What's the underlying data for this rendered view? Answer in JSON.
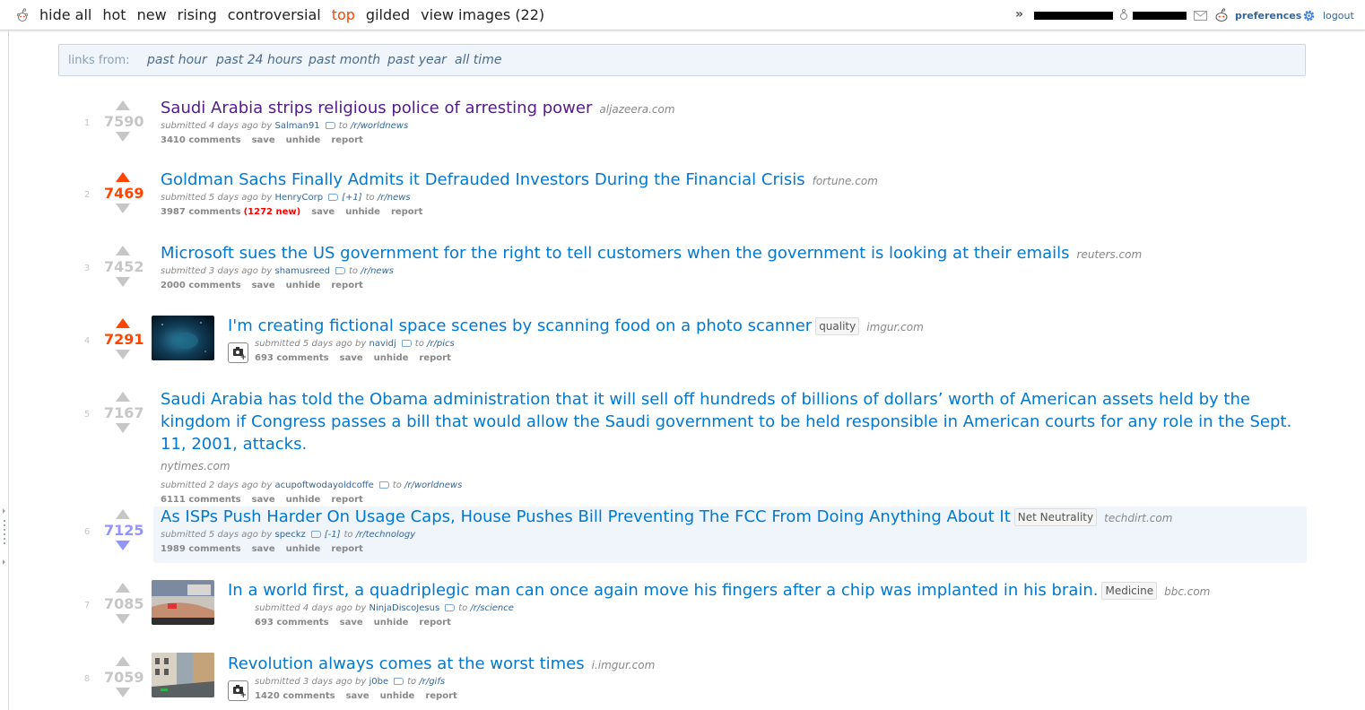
{
  "header": {
    "tabs": [
      {
        "label": "hide all",
        "selected": false
      },
      {
        "label": "hot",
        "selected": false
      },
      {
        "label": "new",
        "selected": false
      },
      {
        "label": "rising",
        "selected": false
      },
      {
        "label": "controversial",
        "selected": false
      },
      {
        "label": "top",
        "selected": true
      },
      {
        "label": "gilded",
        "selected": false
      },
      {
        "label": "view images (22)",
        "selected": false
      }
    ],
    "more_label": "»",
    "preferences_label": "preferences",
    "logout_label": "logout"
  },
  "timefilter": {
    "label": "links from:",
    "options": [
      "past hour",
      "past 24 hours",
      "past month",
      "past year",
      "all time"
    ]
  },
  "posts": [
    {
      "rank": "1",
      "score": "7590",
      "vote_state": "none",
      "title": "Saudi Arabia strips religious police of arresting power",
      "visited": true,
      "flair": "",
      "domain": "aljazeera.com",
      "submitted": "submitted 4 days ago by",
      "author": "Salman91",
      "vote_tag": "",
      "to_label": "to",
      "subreddit": "/r/worldnews",
      "comments": "3410 comments",
      "new_comments": "",
      "actions": [
        "save",
        "unhide",
        "report"
      ],
      "thumbnail": "none"
    },
    {
      "rank": "2",
      "score": "7469",
      "vote_state": "up",
      "title": "Goldman Sachs Finally Admits it Defrauded Investors During the Financial Crisis",
      "visited": false,
      "flair": "",
      "domain": "fortune.com",
      "submitted": "submitted 5 days ago by",
      "author": "HenryCorp",
      "vote_tag": "[+1]",
      "to_label": "to",
      "subreddit": "/r/news",
      "comments": "3987 comments",
      "new_comments": "(1272 new)",
      "actions": [
        "save",
        "unhide",
        "report"
      ],
      "thumbnail": "none"
    },
    {
      "rank": "3",
      "score": "7452",
      "vote_state": "none",
      "title": "Microsoft sues the US government for the right to tell customers when the government is looking at their emails",
      "visited": false,
      "flair": "",
      "domain": "reuters.com",
      "submitted": "submitted 3 days ago by",
      "author": "shamusreed",
      "vote_tag": "",
      "to_label": "to",
      "subreddit": "/r/news",
      "comments": "2000 comments",
      "new_comments": "",
      "actions": [
        "save",
        "unhide",
        "report"
      ],
      "thumbnail": "none"
    },
    {
      "rank": "4",
      "score": "7291",
      "vote_state": "up",
      "title": "I'm creating fictional space scenes by scanning food on a photo scanner",
      "visited": false,
      "flair": "quality",
      "domain": "imgur.com",
      "submitted": "submitted 5 days ago by",
      "author": "navidj",
      "vote_tag": "",
      "to_label": "to",
      "subreddit": "/r/pics",
      "comments": "693 comments",
      "new_comments": "",
      "actions": [
        "save",
        "unhide",
        "report"
      ],
      "thumbnail": "space"
    },
    {
      "rank": "5",
      "score": "7167",
      "vote_state": "none",
      "title": "Saudi Arabia has told the Obama administration that it will sell off hundreds of billions of dollars’ worth of American assets held by the kingdom if Congress passes a bill that would allow the Saudi government to be held responsible in American courts for any role in the Sept. 11, 2001, attacks.",
      "visited": false,
      "flair": "",
      "domain": "nytimes.com",
      "submitted": "submitted 2 days ago by",
      "author": "acupoftwodayoldcoffe",
      "vote_tag": "",
      "to_label": "to",
      "subreddit": "/r/worldnews",
      "comments": "6111 comments",
      "new_comments": "",
      "actions": [
        "save",
        "unhide",
        "report"
      ],
      "thumbnail": "none"
    },
    {
      "rank": "6",
      "score": "7125",
      "vote_state": "down",
      "title": "As ISPs Push Harder On Usage Caps, House Pushes Bill Preventing The FCC From Doing Anything About It",
      "visited": false,
      "flair": "Net Neutrality",
      "domain": "techdirt.com",
      "submitted": "submitted 5 days ago by",
      "author": "speckz",
      "vote_tag": "[-1]",
      "to_label": "to",
      "subreddit": "/r/technology",
      "comments": "1989 comments",
      "new_comments": "",
      "actions": [
        "save",
        "unhide",
        "report"
      ],
      "thumbnail": "none"
    },
    {
      "rank": "7",
      "score": "7085",
      "vote_state": "none",
      "title": "In a world first, a quadriplegic man can once again move his fingers after a chip was implanted in his brain.",
      "visited": false,
      "flair": "Medicine",
      "domain": "bbc.com",
      "submitted": "submitted 4 days ago by",
      "author": "NinjaDiscoJesus",
      "vote_tag": "",
      "to_label": "to",
      "subreddit": "/r/science",
      "comments": "693 comments",
      "new_comments": "",
      "actions": [
        "save",
        "unhide",
        "report"
      ],
      "thumbnail": "hand"
    },
    {
      "rank": "8",
      "score": "7059",
      "vote_state": "none",
      "title": "Revolution always comes at the worst times",
      "visited": false,
      "flair": "",
      "domain": "i.imgur.com",
      "submitted": "submitted 3 days ago by",
      "author": "j0be",
      "vote_tag": "",
      "to_label": "to",
      "subreddit": "/r/gifs",
      "comments": "1420 comments",
      "new_comments": "",
      "actions": [
        "save",
        "unhide",
        "report"
      ],
      "thumbnail": "street"
    }
  ],
  "colors": {
    "accent_orange": "#ff4500",
    "link_blue": "#0079d3",
    "visited_purple": "#551a8b",
    "downvote_blue": "#9494ff",
    "muted_gray": "#888888"
  }
}
